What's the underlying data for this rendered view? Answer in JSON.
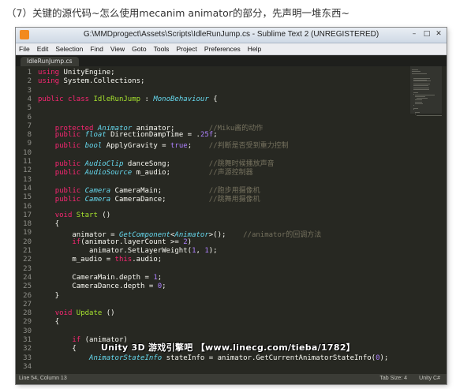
{
  "caption": "（7）关键的源代码~怎么使用mecanim animator的部分，先声明一堆东西~",
  "window": {
    "title": "G:\\MMDprogect\\Assets\\Scripts\\IdleRunJump.cs - Sublime Text 2 (UNREGISTERED)",
    "controls": [
      "–",
      "□",
      "✕"
    ]
  },
  "menu": [
    "File",
    "Edit",
    "Selection",
    "Find",
    "View",
    "Goto",
    "Tools",
    "Project",
    "Preferences",
    "Help"
  ],
  "tab": "IdleRunJump.cs",
  "lines": [
    {
      "n": "1",
      "code": "using UnityEngine;"
    },
    {
      "n": "2",
      "code": "using System.Collections;"
    },
    {
      "n": "3",
      "code": ""
    },
    {
      "n": "4",
      "code": "public class IdleRunJump : MonoBehaviour {"
    },
    {
      "n": "5",
      "code": ""
    },
    {
      "n": "6",
      "code": ""
    },
    {
      "n": "7",
      "code": "    protected Animator animator;        //Miku酱的动作"
    },
    {
      "n": "8",
      "code": "    public float DirectionDampTime = .25f;"
    },
    {
      "n": "9",
      "code": "    public bool ApplyGravity = true;    //判断是否受到重力控制"
    },
    {
      "n": "10",
      "code": ""
    },
    {
      "n": "11",
      "code": "    public AudioClip danceSong;         //跳舞时候播放声音"
    },
    {
      "n": "12",
      "code": "    public AudioSource m_audio;         //声源控制器"
    },
    {
      "n": "13",
      "code": ""
    },
    {
      "n": "14",
      "code": "    public Camera CameraMain;           //跑步用摄像机"
    },
    {
      "n": "15",
      "code": "    public Camera CameraDance;          //跳舞用摄像机"
    },
    {
      "n": "16",
      "code": ""
    },
    {
      "n": "17",
      "code": "    void Start ()"
    },
    {
      "n": "18",
      "code": "    {"
    },
    {
      "n": "19",
      "code": "        animator = GetComponent<Animator>();    //animator的回调方法"
    },
    {
      "n": "20",
      "code": "        if(animator.layerCount >= 2)"
    },
    {
      "n": "21",
      "code": "            animator.SetLayerWeight(1, 1);"
    },
    {
      "n": "22",
      "code": "        m_audio = this.audio;"
    },
    {
      "n": "23",
      "code": ""
    },
    {
      "n": "24",
      "code": "        CameraMain.depth = 1;"
    },
    {
      "n": "25",
      "code": "        CameraDance.depth = 0;"
    },
    {
      "n": "26",
      "code": "    }"
    },
    {
      "n": "27",
      "code": ""
    },
    {
      "n": "28",
      "code": "    void Update ()"
    },
    {
      "n": "29",
      "code": "    {"
    },
    {
      "n": "30",
      "code": ""
    },
    {
      "n": "31",
      "code": "        if (animator)"
    },
    {
      "n": "32",
      "code": "        {"
    },
    {
      "n": "33",
      "code": "            AnimatorStateInfo stateInfo = animator.GetCurrentAnimatorStateInfo(0);"
    },
    {
      "n": "34",
      "code": ""
    }
  ],
  "status": {
    "position": "Line 54, Column 13",
    "tab_size": "Tab Size: 4",
    "syntax": "Unity C#"
  },
  "watermark": "Unity 3D 游戏引擎吧 【www.linecg.com/tieba/1782】",
  "colors": {
    "background": "#272822",
    "keyword": "#f92672",
    "type": "#66d9ef",
    "comment": "#75715e",
    "number": "#ae81ff",
    "class_name": "#a6e22e"
  }
}
